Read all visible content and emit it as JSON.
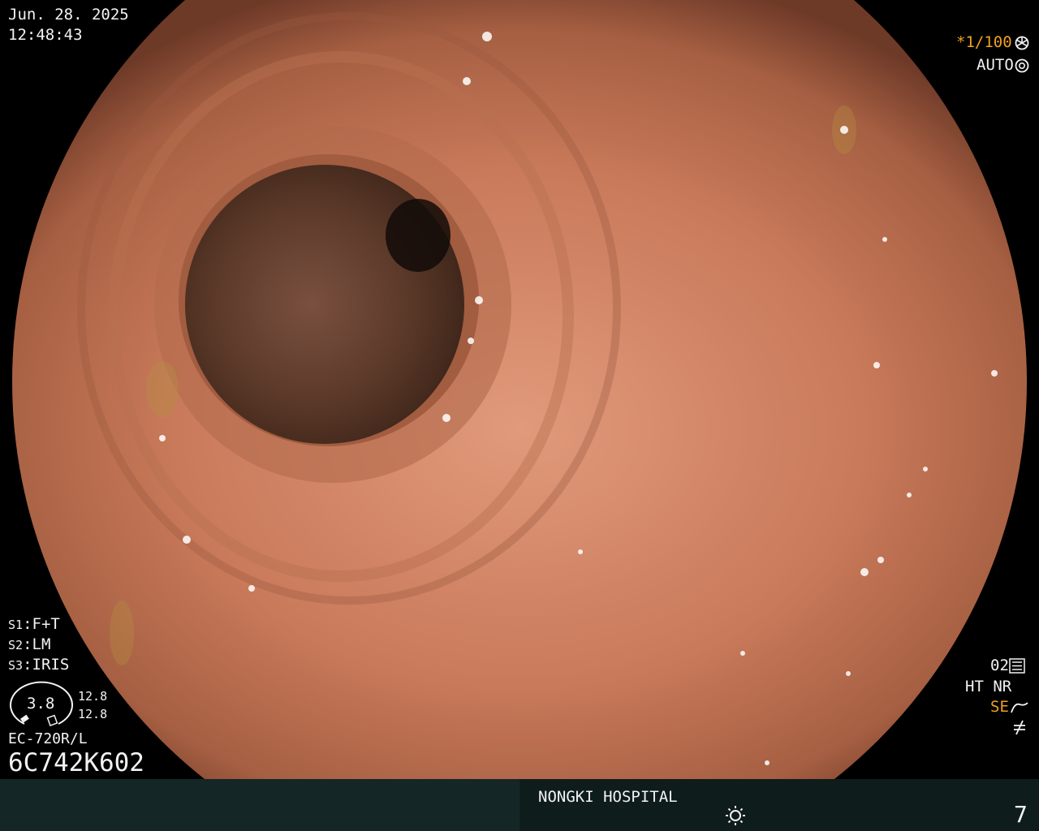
{
  "date": "Jun. 28. 2025",
  "time": "12:48:43",
  "shutter": "*1/100",
  "shutter_icon": "aperture-icon",
  "exposure": "AUTO",
  "exposure_icon": "iris-icon",
  "settings": [
    {
      "key": "S1",
      "value": "F+T"
    },
    {
      "key": "S2",
      "value": "LM"
    },
    {
      "key": "S3",
      "value": "IRIS"
    }
  ],
  "gauge": {
    "value": "3.8",
    "top": "12.8",
    "bottom": "12.8"
  },
  "scope_model": "EC-720R/L",
  "serial": "6C742K602",
  "right_panel": {
    "mode": "02",
    "mode_icon": "menu-sliders-icon",
    "ht_nr": "HT NR",
    "se": "SE",
    "se_icon": "curve-icon",
    "slash_icon": "not-equal-icon"
  },
  "hospital": "NONGKI HOSPITAL",
  "light_icon": "sun-icon",
  "page_number": "7",
  "colors": {
    "mucosa": "#c87858",
    "lumen": "#3a2318",
    "bar_left": "#142626",
    "bar_right": "#0f1c1c",
    "accent": "#f0a020"
  }
}
